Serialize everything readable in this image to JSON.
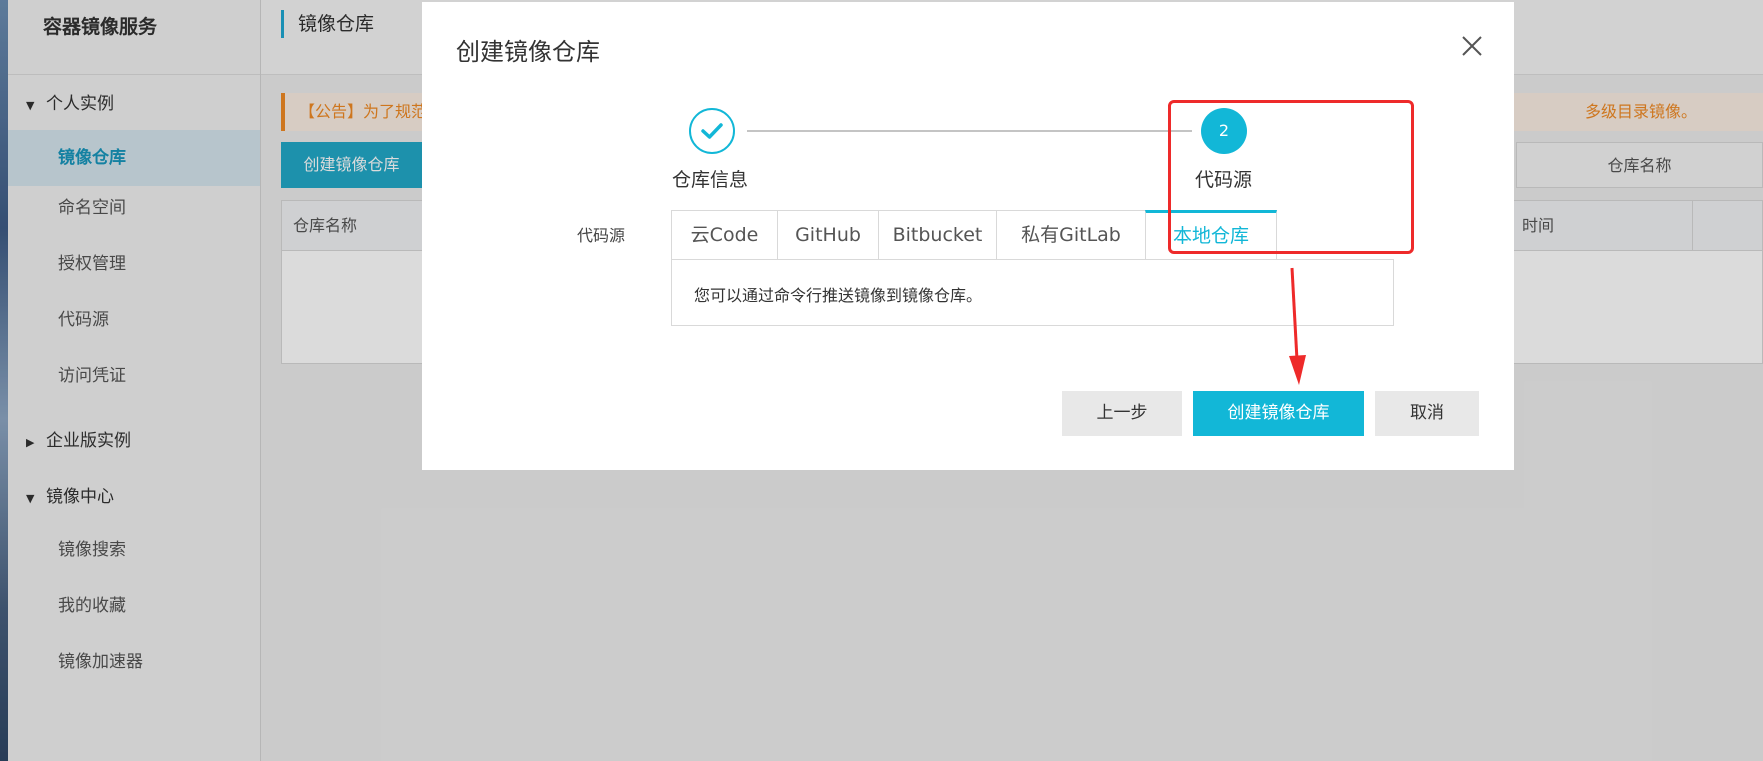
{
  "sidebar": {
    "title": "容器镜像服务",
    "groups": [
      {
        "label": "个人实例",
        "expanded": true
      },
      {
        "label": "企业版实例",
        "expanded": false
      },
      {
        "label": "镜像中心",
        "expanded": true
      }
    ],
    "items": [
      "镜像仓库",
      "命名空间",
      "授权管理",
      "代码源",
      "访问凭证",
      "镜像搜索",
      "我的收藏",
      "镜像加速器"
    ],
    "active_item": "镜像仓库"
  },
  "main": {
    "title": "镜像仓库",
    "notice_left": "【公告】为了规范",
    "notice_right": "多级目录镜像。",
    "create_button": "创建镜像仓库",
    "search_placeholder": "仓库名称",
    "table_headers": [
      "仓库名称",
      "时间"
    ]
  },
  "modal": {
    "title": "创建镜像仓库",
    "steps": [
      {
        "label": "仓库信息",
        "status": "done"
      },
      {
        "label": "代码源",
        "number": "2",
        "status": "active"
      }
    ],
    "code_source_label": "代码源",
    "tabs": [
      "云Code",
      "GitHub",
      "Bitbucket",
      "私有GitLab",
      "本地仓库"
    ],
    "active_tab": "本地仓库",
    "panel_text": "您可以通过命令行推送镜像到镜像仓库。",
    "buttons": {
      "prev": "上一步",
      "create": "创建镜像仓库",
      "cancel": "取消"
    }
  },
  "colors": {
    "accent": "#12b7d7",
    "highlight": "#ee2a2a",
    "notice": "#f08a24"
  }
}
